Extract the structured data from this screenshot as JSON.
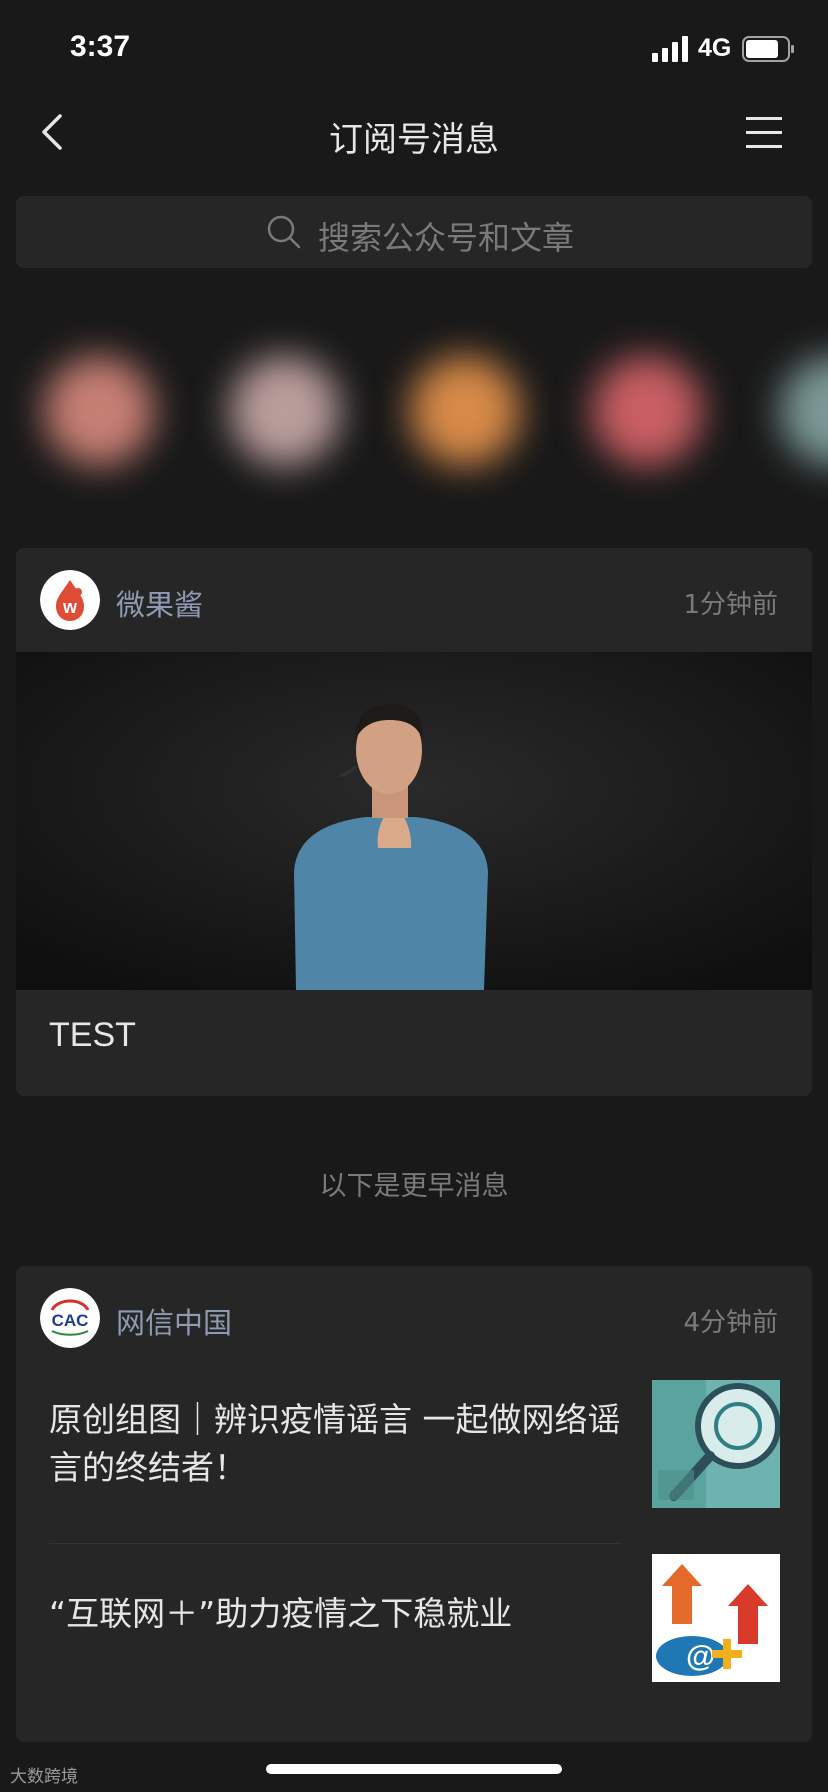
{
  "status": {
    "time": "3:37",
    "network": "4G"
  },
  "nav": {
    "title": "订阅号消息"
  },
  "search": {
    "placeholder": "搜索公众号和文章"
  },
  "cards": [
    {
      "account": "微果酱",
      "time": "1分钟前",
      "headline": "TEST"
    }
  ],
  "divider_text": "以下是更早消息",
  "older": {
    "account": "网信中国",
    "time": "4分钟前",
    "articles": [
      {
        "title": "原创组图｜辨识疫情谣言 一起做网络谣言的终结者！"
      },
      {
        "title": "“互联网＋”助力疫情之下稳就业"
      }
    ],
    "avatar_text": "CAC"
  },
  "watermark": "大数跨境",
  "colors": {
    "background": "#191919",
    "card": "#262626",
    "account_name": "#8f9bb3"
  }
}
